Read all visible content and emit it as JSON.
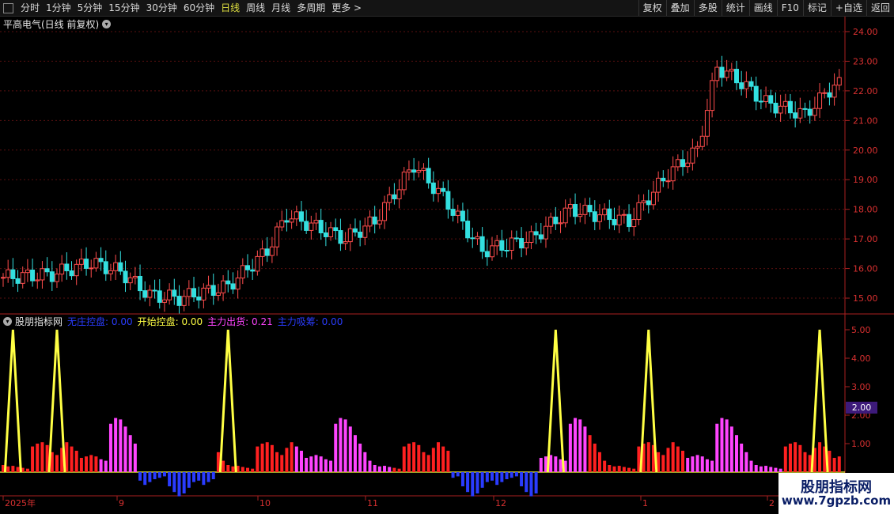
{
  "toolbar": {
    "periods": [
      "分时",
      "1分钟",
      "5分钟",
      "15分钟",
      "30分钟",
      "60分钟",
      "日线",
      "周线",
      "月线",
      "多周期",
      "更多 >"
    ],
    "active_period": "日线",
    "right_buttons": [
      "复权",
      "叠加",
      "多股",
      "统计",
      "画线",
      "F10",
      "标记",
      "+自选",
      "返回"
    ]
  },
  "caption": {
    "title": "平高电气(日线 前复权)"
  },
  "indicator": {
    "name": "股朋指标网",
    "items": [
      {
        "label": "无庄控盘: 0.00",
        "color": "#2a3cff"
      },
      {
        "label": "开始控盘: 0.00",
        "color": "#ffff44"
      },
      {
        "label": "主力出货: 0.21",
        "color": "#ff44ff"
      },
      {
        "label": "主力吸筹: 0.00",
        "color": "#2a3cff"
      }
    ],
    "current_value": "2.00"
  },
  "watermark": {
    "title": "股朋指标网",
    "url": "www.7gpzb.com"
  },
  "colors": {
    "up": "#ff4d4d",
    "down": "#33e0e0",
    "grid": "#5a1010",
    "axis": "#aa2020"
  },
  "chart_data": [
    {
      "type": "candlestick",
      "title": "平高电气(日线 前复权)",
      "ylim": [
        14.6,
        24.4
      ],
      "yticks": [
        15.0,
        16.0,
        17.0,
        18.0,
        19.0,
        20.0,
        21.0,
        22.0,
        23.0,
        24.0
      ],
      "tick_labels": [
        "15.00",
        "16.00",
        "17.00",
        "18.00",
        "19.00",
        "20.00",
        "21.00",
        "22.00",
        "23.00",
        "24.00"
      ],
      "series": [
        {
          "name": "segment",
          "values": [
            [
              15.6,
              15.85,
              15.55,
              15.9
            ],
            [
              15.85,
              15.8,
              15.7,
              16.0
            ],
            [
              15.8,
              15.7,
              15.6,
              15.9
            ]
          ]
        }
      ],
      "x_labels": [
        "2025年",
        "9",
        "10",
        "11",
        "12",
        "1",
        "2"
      ]
    },
    {
      "type": "bar",
      "ylim": [
        0,
        5.3
      ],
      "yticks": [
        1.0,
        2.0,
        3.0,
        4.0,
        5.0
      ],
      "tick_labels": [
        "1.00",
        "2.00",
        "3.00",
        "4.00",
        "5.00"
      ],
      "peaks_index": [
        2,
        11,
        46,
        113,
        132,
        167
      ],
      "peak_value": 5.0,
      "series": [
        {
          "name": "主力出货",
          "values": [
            0.25,
            0.2,
            0.22,
            0.18,
            0.15,
            0.12,
            0.9,
            1.0,
            1.05,
            0.95,
            0.7,
            0.6,
            0.85,
            1.05,
            0.9,
            0.75,
            0.5,
            0.55,
            0.6,
            0.55,
            0.45,
            0.4,
            1.7,
            1.9,
            1.85,
            1.6,
            1.3,
            1.0,
            0.7,
            0.4
          ]
        },
        {
          "name": "主力吸筹",
          "values": [
            -0.3,
            -0.45,
            -0.35,
            -0.25,
            -0.2,
            -0.15,
            -0.5,
            -0.7,
            -0.85,
            -0.75,
            -0.55,
            -0.35
          ]
        }
      ]
    }
  ]
}
